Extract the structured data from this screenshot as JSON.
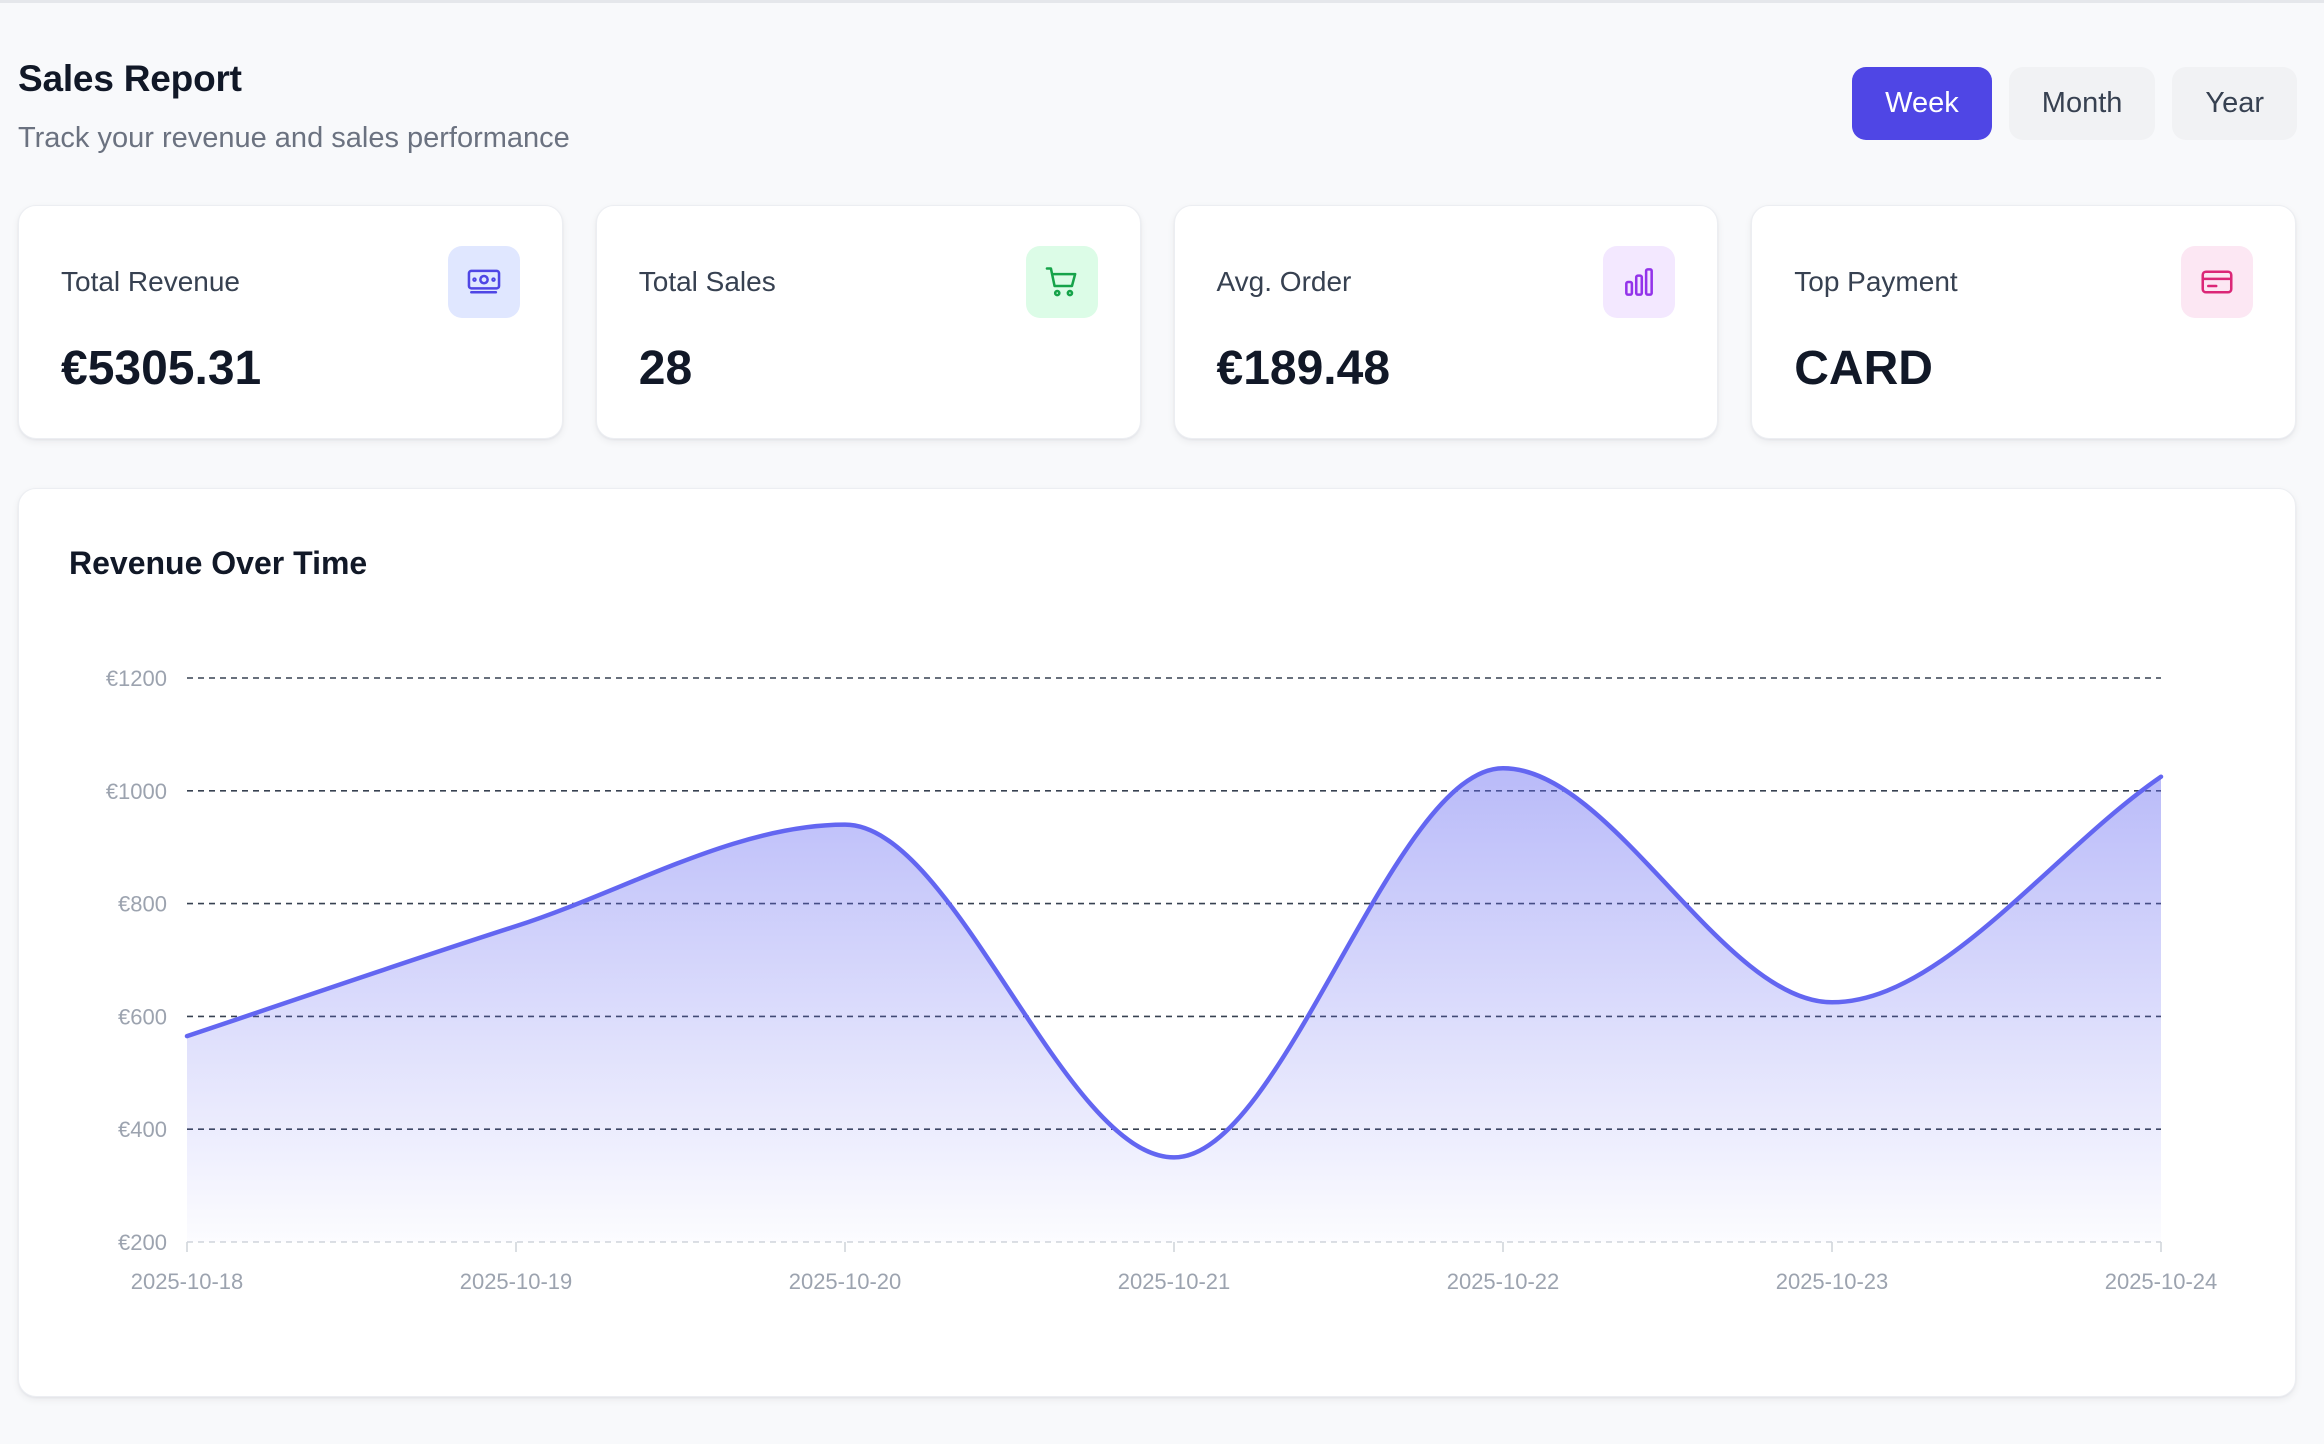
{
  "header": {
    "title": "Sales Report",
    "subtitle": "Track your revenue and sales performance"
  },
  "range_toggle": {
    "options": [
      "Week",
      "Month",
      "Year"
    ],
    "selected": "Week"
  },
  "stats": [
    {
      "label": "Total Revenue",
      "value": "€5305.31",
      "icon": "banknote-icon",
      "icon_color": "#4f46e5",
      "icon_bg": "#e0e7ff"
    },
    {
      "label": "Total Sales",
      "value": "28",
      "icon": "shopping-cart-icon",
      "icon_color": "#16a34a",
      "icon_bg": "#dcfce7"
    },
    {
      "label": "Avg. Order",
      "value": "€189.48",
      "icon": "bar-chart-icon",
      "icon_color": "#9333ea",
      "icon_bg": "#f3e8ff"
    },
    {
      "label": "Top Payment",
      "value": "CARD",
      "icon": "credit-card-icon",
      "icon_color": "#db2777",
      "icon_bg": "#fce7f3"
    }
  ],
  "chart": {
    "title": "Revenue Over Time"
  },
  "colors": {
    "accent": "#4f46e5",
    "line": "#6366f1"
  },
  "chart_data": {
    "type": "area",
    "x": [
      "2025-10-18",
      "2025-10-19",
      "2025-10-20",
      "2025-10-21",
      "2025-10-22",
      "2025-10-23",
      "2025-10-24"
    ],
    "series": [
      {
        "values": [
          565,
          760,
          940,
          350,
          1040,
          625,
          1025
        ]
      }
    ],
    "ylim": [
      200,
      1200
    ],
    "yticks": [
      200,
      400,
      600,
      800,
      1000,
      1200
    ],
    "ytick_prefix": "€",
    "grid": true,
    "gridline_style": "dashed",
    "legend": "none"
  }
}
